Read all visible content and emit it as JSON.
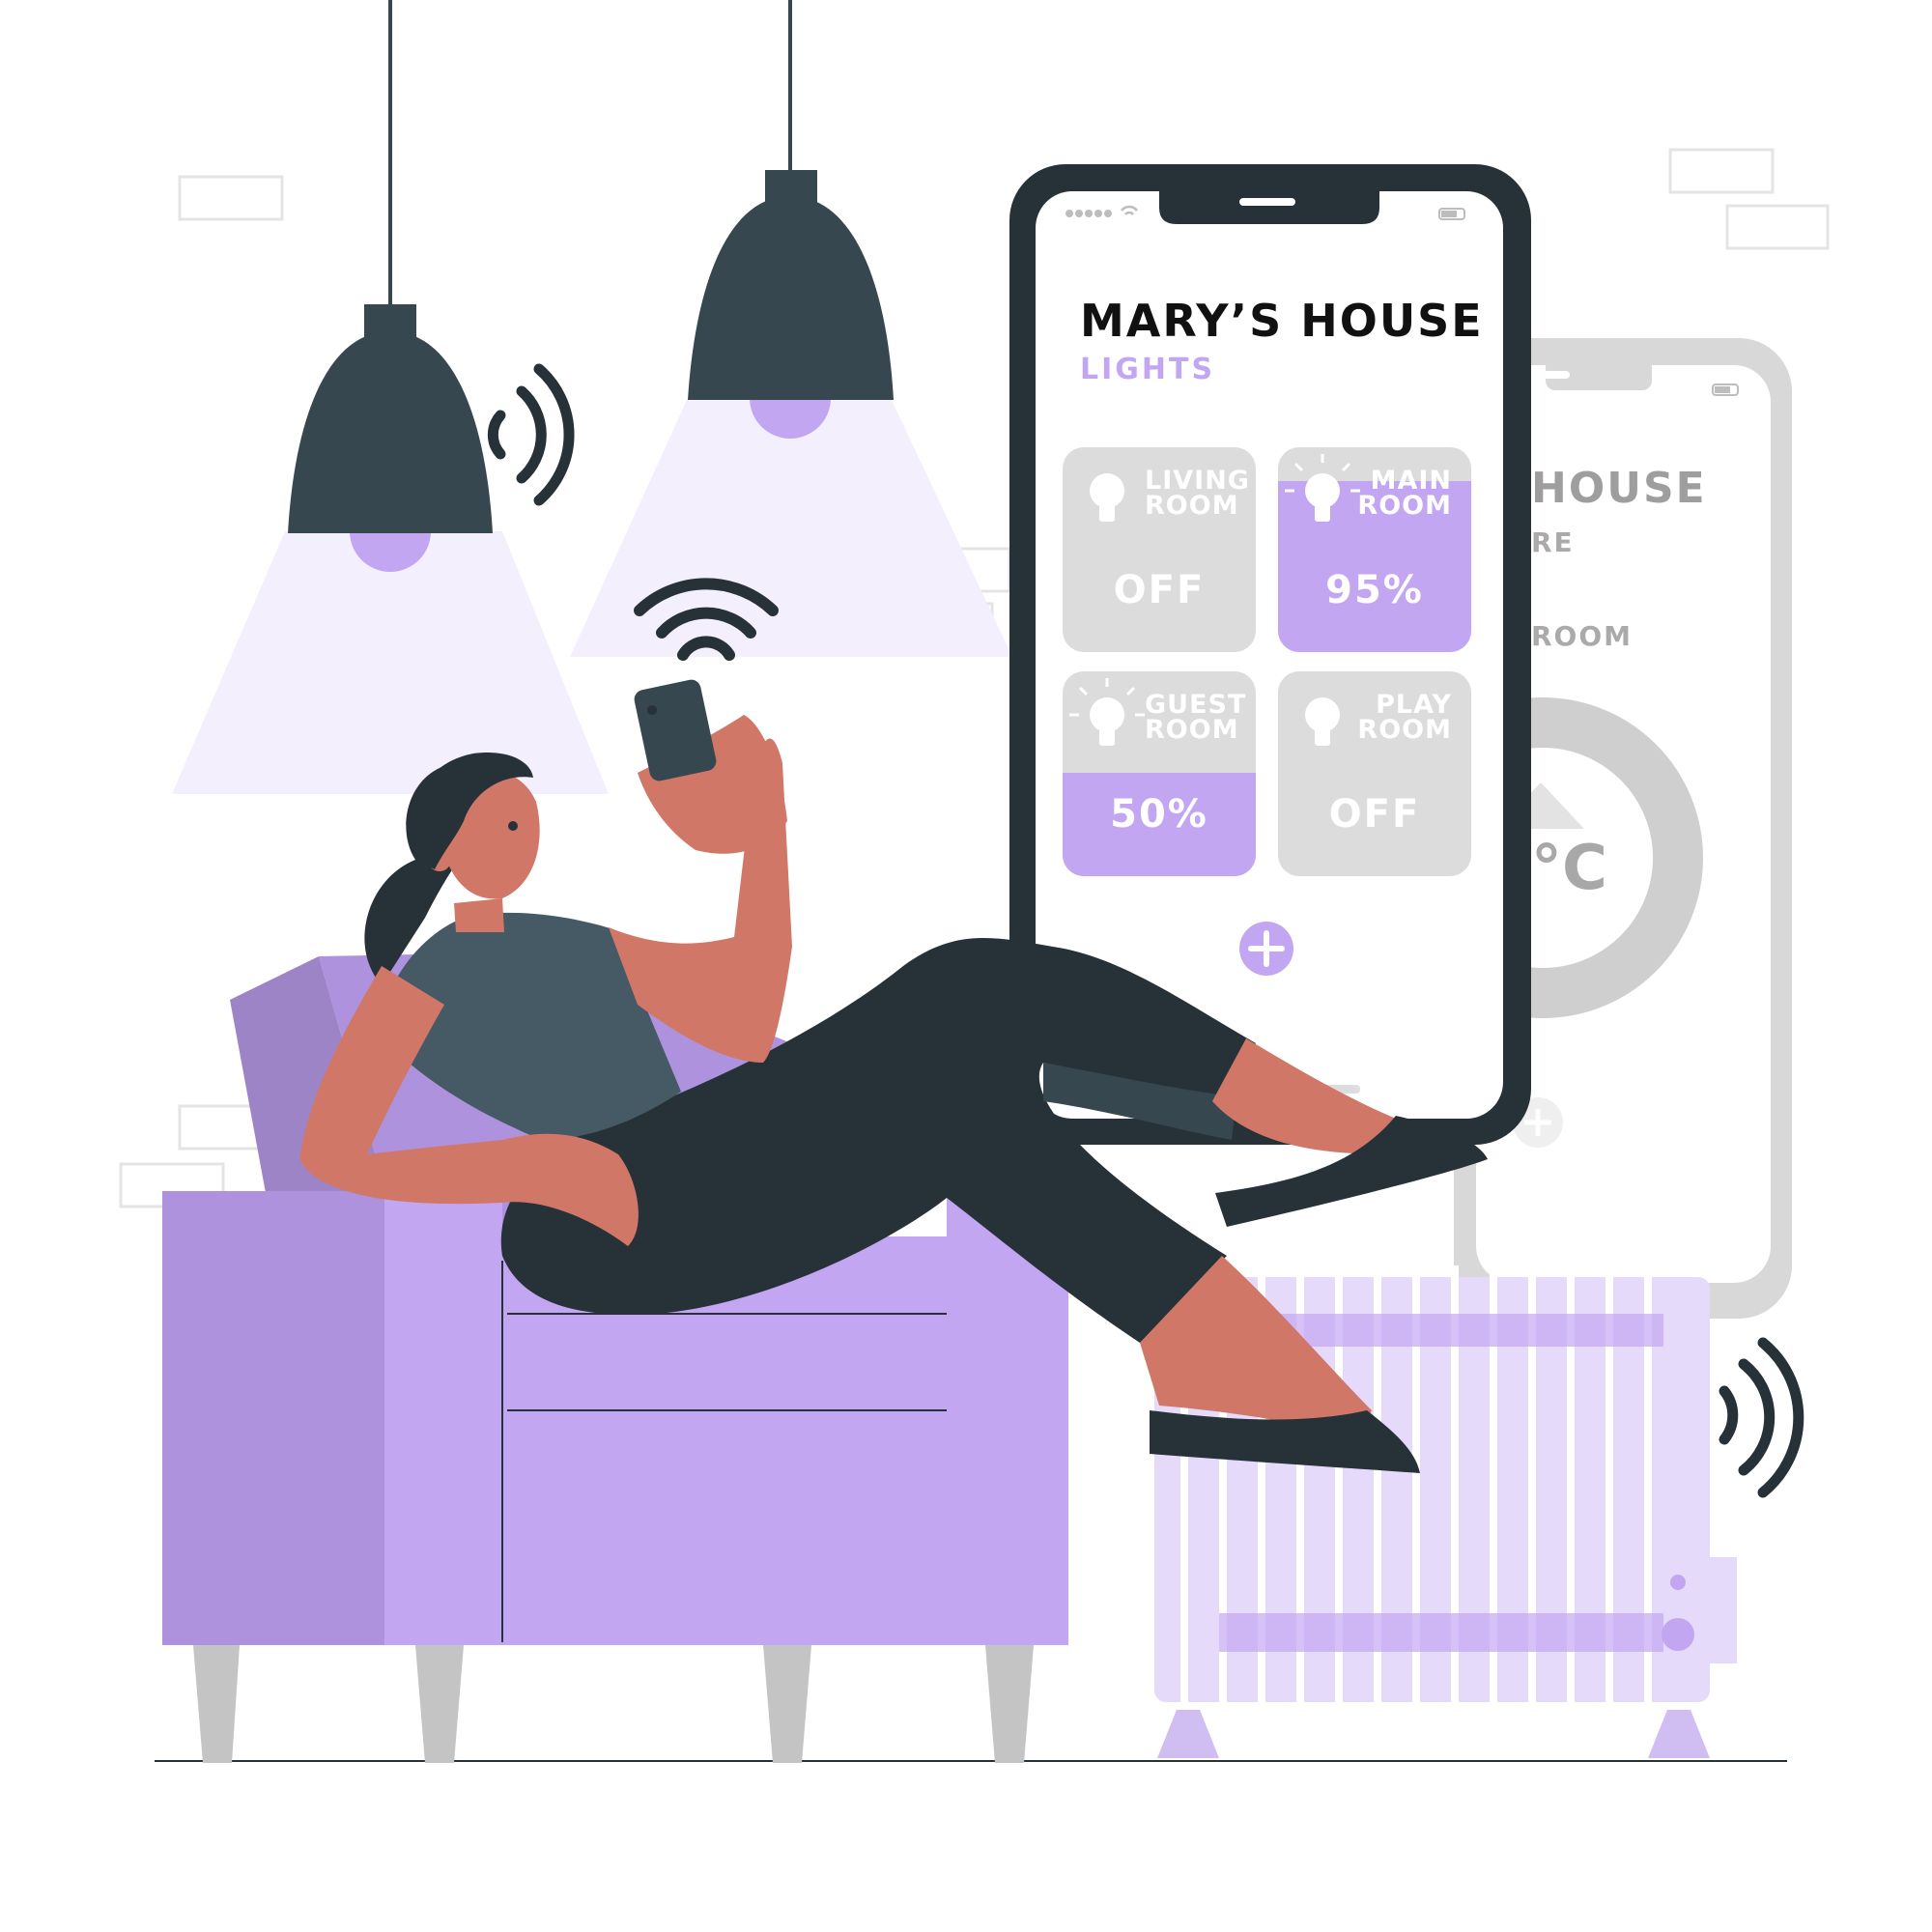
{
  "phone": {
    "title": "MARY’S HOUSE",
    "section": "LIGHTS",
    "tiles": [
      {
        "label_line1": "LIVING",
        "label_line2": "ROOM",
        "value": "OFF",
        "state": "off",
        "level": 0
      },
      {
        "label_line1": "MAIN",
        "label_line2": "ROOM",
        "value": "95%",
        "state": "on",
        "level": 0.95
      },
      {
        "label_line1": "GUEST",
        "label_line2": "ROOM",
        "value": "50%",
        "state": "on",
        "level": 0.5
      },
      {
        "label_line1": "PLAY",
        "label_line2": "ROOM",
        "value": "OFF",
        "state": "off",
        "level": 0
      }
    ],
    "add_icon": "plus-icon"
  },
  "back_phone": {
    "title_fragment": "HOUSE",
    "sub_fragment": "RE",
    "room_fragment": "ROOM",
    "temp_fragment": "°C"
  },
  "colors": {
    "accent": "#C3A6F2",
    "accent_dark": "#A98DD6",
    "tile_off": "#DCDCDC",
    "dark": "#263238",
    "skin": "#D17768",
    "lamp": "#37474F",
    "light_cone": "#F3EFFD"
  },
  "icons": [
    "bulb-icon",
    "wifi-icon",
    "signal-waves-icon",
    "plus-icon"
  ]
}
